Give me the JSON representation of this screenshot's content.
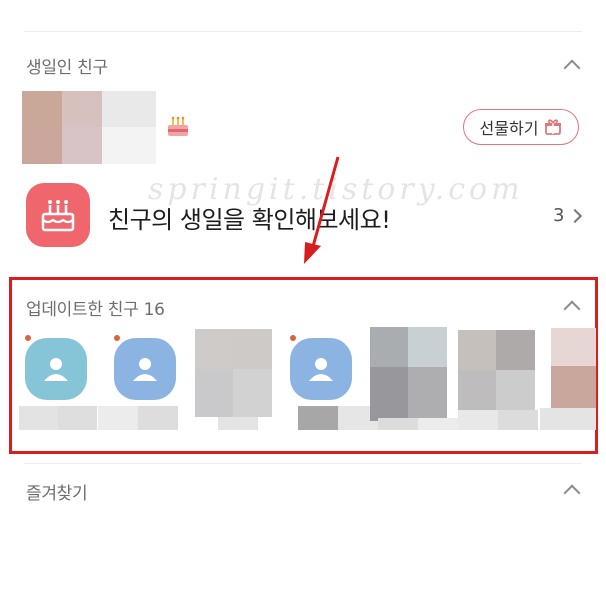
{
  "birthday_section": {
    "title": "생일인 친구",
    "gift_button_label": "선물하기",
    "prompt_text": "친구의 생일을 확인해보세요!",
    "count": "3"
  },
  "updated_section": {
    "title": "업데이트한 친구 16"
  },
  "favorites_section": {
    "title": "즐겨찾기"
  },
  "watermark": "springit.tistory.com",
  "colors": {
    "highlight": "#d81e1e",
    "cake_tile": "#f0666d",
    "gift_border": "#e0777a",
    "avatar_teal": "#86c4d8",
    "avatar_blue": "#8cb4e2"
  },
  "icons": [
    "chevron-up-icon",
    "cake-icon",
    "gift-icon",
    "chevron-right-icon",
    "person-icon"
  ]
}
